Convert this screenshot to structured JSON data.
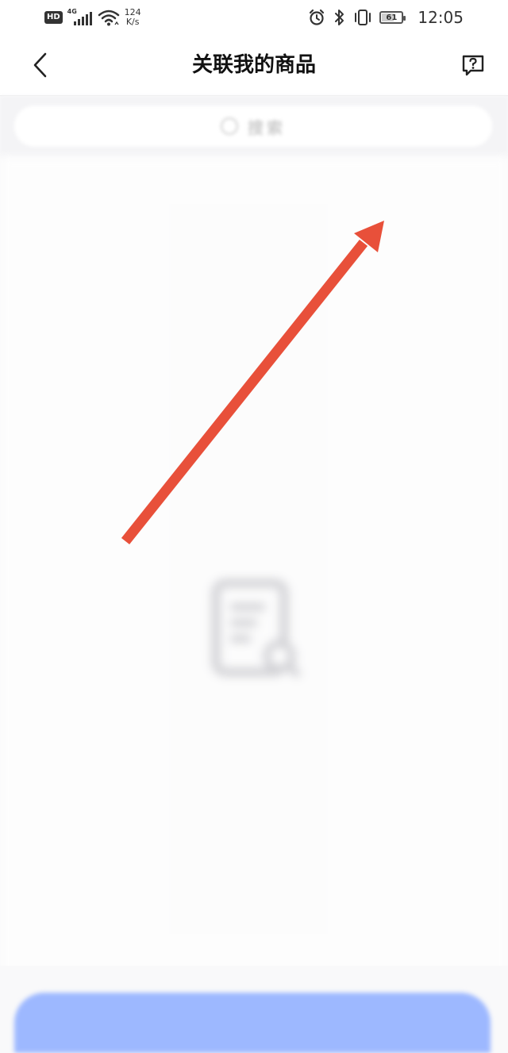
{
  "status_bar": {
    "hd": "HD",
    "network_type": "4G",
    "speed_value": "124",
    "speed_unit": "K/s",
    "battery": "61",
    "battery_level_percent": 61,
    "time": "12:05"
  },
  "header": {
    "title": "关联我的商品"
  },
  "search": {
    "placeholder": "搜索"
  },
  "colors": {
    "primary_button": "#9db8ff",
    "arrow": "#e8503a",
    "background": "#f9f9fa"
  },
  "icons": {
    "back": "chevron-left-icon",
    "help": "help-icon",
    "search": "search-icon",
    "empty": "empty-document-icon",
    "alarm": "alarm-icon",
    "bluetooth": "bluetooth-icon",
    "vibrate": "vibrate-icon",
    "wifi": "wifi-icon",
    "signal": "signal-icon",
    "battery": "battery-icon"
  }
}
